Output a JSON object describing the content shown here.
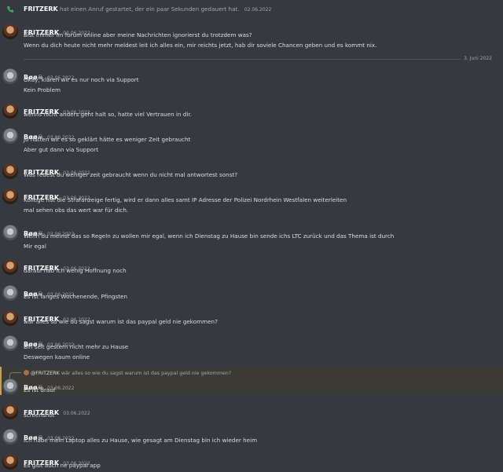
{
  "call": {
    "user": "FRITZERK",
    "text": "hat einen Anruf gestartet, der ein paar Sekunden gedauert hat.",
    "date": "02.06.2022"
  },
  "divider": {
    "label": "3. Juni 2022"
  },
  "reply": {
    "user": "@FRITZERK",
    "text": "wär alles so wie du sagst warum ist das paypal geld nie gekommen?"
  },
  "messages": [
    {
      "user": "FRITZERK",
      "time": "02.06.2022",
      "lines": [
        "Bist immer im forum online aber meine Nachrichten ignorierst du trotzdem was?",
        "Wenn du dich heute nicht mehr meldest leit ich alles ein, mir reichts jetzt, hab dir soviele Chancen geben und es kommt nix."
      ]
    },
    {
      "user": "Bøø☠",
      "time": "03.06.2022",
      "lines": [
        "Okay, klären wir es nur noch via Support",
        "Kein Problem"
      ]
    },
    {
      "user": "FRITZERK",
      "time": "03.06.2022",
      "lines": [
        "wenns  nicht anders geht halt so, hatte viel Vertrauen in dir."
      ]
    },
    {
      "user": "Bøø☠",
      "time": "03.06.2022",
      "lines": [
        "Jo hätten wir es so geklärt hätte es weniger Zeit gebraucht",
        "Aber gut dann via Support"
      ]
    },
    {
      "user": "FRITZERK",
      "time": "03.06.2022",
      "lines": [
        "Was redest du weniger zeit gebraucht wenn du nicht mal antwortest sonst?"
      ]
    },
    {
      "user": "FRITZERK",
      "time": "03.06.2022",
      "lines": [
        "Kollege hat die Strafanzeige fertig, wird er dann alles samt IP Adresse der Polizei Nordrhein Westfalen weiterleiten",
        "mal sehen obs das wert war für dich."
      ]
    },
    {
      "user": "Bøø☠",
      "time": "03.06.2022",
      "lines": [
        "Wenn du meinst das so Regeln zu wollen mir egal, wenn ich Dienstag zu Hause bin sende ichs LTC zurück und das Thema ist durch",
        "Mir egal"
      ]
    },
    {
      "user": "FRITZERK",
      "time": "03.06.2022",
      "lines": [
        "darauf hab ich wenig Hoffnung noch"
      ]
    },
    {
      "user": "Bøø☠",
      "time": "03.06.2022",
      "lines": [
        "Es ist langes Wochenende, Pfingsten"
      ]
    },
    {
      "user": "FRITZERK",
      "time": "03.06.2022",
      "lines": [
        "wär alles so wie du sagst warum ist das paypal geld nie gekommen?"
      ]
    },
    {
      "user": "Bøø☠",
      "time": "03.06.2022",
      "lines": [
        "Bin seit gestern nicht mehr zu Hause",
        "Deswegen kaum online"
      ]
    },
    {
      "user": "Bøø☠",
      "time": "03.06.2022",
      "lines": [
        "Es ist drauf"
      ]
    },
    {
      "user": "FRITZERK",
      "time": "03.06.2022",
      "lines": [
        "screenshot"
      ]
    },
    {
      "user": "Bøø☠",
      "time": "03.06.2022",
      "lines": [
        "Ich habe mein Laptop alles zu Hause, wie gesagt am Dienstag bin ich wieder heim"
      ]
    },
    {
      "user": "FRITZERK",
      "time": "03.06.2022",
      "lines": [
        "Es gibt auch ne paypal app"
      ]
    }
  ]
}
